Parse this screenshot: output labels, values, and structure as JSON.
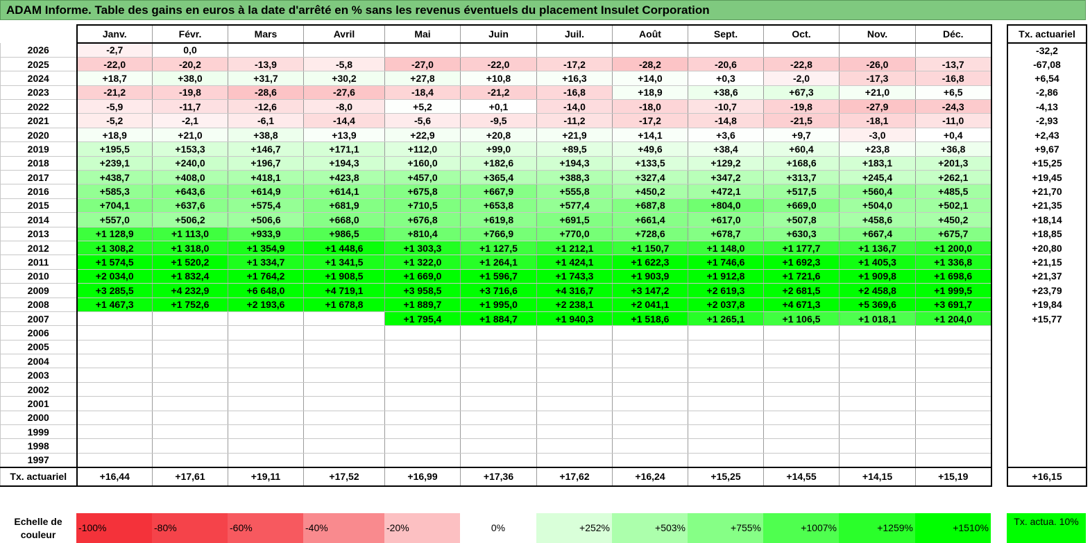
{
  "title": "ADAM Informe. Table des gains en euros à la date d'arrêté en % sans les revenus éventuels du placement Insulet Corporation",
  "chart_data": {
    "type": "table",
    "title": "ADAM Informe. Table des gains en euros à la date d'arrêté en % sans les revenus éventuels du placement Insulet Corporation",
    "columns": [
      "Janv.",
      "Févr.",
      "Mars",
      "Avril",
      "Mai",
      "Juin",
      "Juil.",
      "Août",
      "Sept.",
      "Oct.",
      "Nov.",
      "Déc."
    ],
    "side_header": "Tx. actuariel",
    "rows": [
      {
        "year": "2026",
        "values": [
          "-2,7",
          "0,0",
          "",
          "",
          "",
          "",
          "",
          "",
          "",
          "",
          "",
          ""
        ],
        "tx": "-32,2"
      },
      {
        "year": "2025",
        "values": [
          "-22,0",
          "-20,2",
          "-13,9",
          "-5,8",
          "-27,0",
          "-22,0",
          "-17,2",
          "-28,2",
          "-20,6",
          "-22,8",
          "-26,0",
          "-13,7"
        ],
        "tx": "-67,08"
      },
      {
        "year": "2024",
        "values": [
          "+18,7",
          "+38,0",
          "+31,7",
          "+30,2",
          "+27,8",
          "+10,8",
          "+16,3",
          "+14,0",
          "+0,3",
          "-2,0",
          "-17,3",
          "-16,8"
        ],
        "tx": "+6,54"
      },
      {
        "year": "2023",
        "values": [
          "-21,2",
          "-19,8",
          "-28,6",
          "-27,6",
          "-18,4",
          "-21,2",
          "-16,8",
          "+18,9",
          "+38,6",
          "+67,3",
          "+21,0",
          "+6,5"
        ],
        "tx": "-2,86"
      },
      {
        "year": "2022",
        "values": [
          "-5,9",
          "-11,7",
          "-12,6",
          "-8,0",
          "+5,2",
          "+0,1",
          "-14,0",
          "-18,0",
          "-10,7",
          "-19,8",
          "-27,9",
          "-24,3"
        ],
        "tx": "-4,13"
      },
      {
        "year": "2021",
        "values": [
          "-5,2",
          "-2,1",
          "-6,1",
          "-14,4",
          "-5,6",
          "-9,5",
          "-11,2",
          "-17,2",
          "-14,8",
          "-21,5",
          "-18,1",
          "-11,0"
        ],
        "tx": "-2,93"
      },
      {
        "year": "2020",
        "values": [
          "+18,9",
          "+21,0",
          "+38,8",
          "+13,9",
          "+22,9",
          "+20,8",
          "+21,9",
          "+14,1",
          "+3,6",
          "+9,7",
          "-3,0",
          "+0,4"
        ],
        "tx": "+2,43"
      },
      {
        "year": "2019",
        "values": [
          "+195,5",
          "+153,3",
          "+146,7",
          "+171,1",
          "+112,0",
          "+99,0",
          "+89,5",
          "+49,6",
          "+38,4",
          "+60,4",
          "+23,8",
          "+36,8"
        ],
        "tx": "+9,67"
      },
      {
        "year": "2018",
        "values": [
          "+239,1",
          "+240,0",
          "+196,7",
          "+194,3",
          "+160,0",
          "+182,6",
          "+194,3",
          "+133,5",
          "+129,2",
          "+168,6",
          "+183,1",
          "+201,3"
        ],
        "tx": "+15,25"
      },
      {
        "year": "2017",
        "values": [
          "+438,7",
          "+408,0",
          "+418,1",
          "+423,8",
          "+457,0",
          "+365,4",
          "+388,3",
          "+327,4",
          "+347,2",
          "+313,7",
          "+245,4",
          "+262,1"
        ],
        "tx": "+19,45"
      },
      {
        "year": "2016",
        "values": [
          "+585,3",
          "+643,6",
          "+614,9",
          "+614,1",
          "+675,8",
          "+667,9",
          "+555,8",
          "+450,2",
          "+472,1",
          "+517,5",
          "+560,4",
          "+485,5"
        ],
        "tx": "+21,70"
      },
      {
        "year": "2015",
        "values": [
          "+704,1",
          "+637,6",
          "+575,4",
          "+681,9",
          "+710,5",
          "+653,8",
          "+577,4",
          "+687,8",
          "+804,0",
          "+669,0",
          "+504,0",
          "+502,1"
        ],
        "tx": "+21,35"
      },
      {
        "year": "2014",
        "values": [
          "+557,0",
          "+506,2",
          "+506,6",
          "+668,0",
          "+676,8",
          "+619,8",
          "+691,5",
          "+661,4",
          "+617,0",
          "+507,8",
          "+458,6",
          "+450,2"
        ],
        "tx": "+18,14"
      },
      {
        "year": "2013",
        "values": [
          "+1 128,9",
          "+1 113,0",
          "+933,9",
          "+986,5",
          "+810,4",
          "+766,9",
          "+770,0",
          "+728,6",
          "+678,7",
          "+630,3",
          "+667,4",
          "+675,7"
        ],
        "tx": "+18,85"
      },
      {
        "year": "2012",
        "values": [
          "+1 308,2",
          "+1 318,0",
          "+1 354,9",
          "+1 448,6",
          "+1 303,3",
          "+1 127,5",
          "+1 212,1",
          "+1 150,7",
          "+1 148,0",
          "+1 177,7",
          "+1 136,7",
          "+1 200,0"
        ],
        "tx": "+20,80"
      },
      {
        "year": "2011",
        "values": [
          "+1 574,5",
          "+1 520,2",
          "+1 334,7",
          "+1 341,5",
          "+1 322,0",
          "+1 264,1",
          "+1 424,1",
          "+1 622,3",
          "+1 746,6",
          "+1 692,3",
          "+1 405,3",
          "+1 336,8"
        ],
        "tx": "+21,15"
      },
      {
        "year": "2010",
        "values": [
          "+2 034,0",
          "+1 832,4",
          "+1 764,2",
          "+1 908,5",
          "+1 669,0",
          "+1 596,7",
          "+1 743,3",
          "+1 903,9",
          "+1 912,8",
          "+1 721,6",
          "+1 909,8",
          "+1 698,6"
        ],
        "tx": "+21,37"
      },
      {
        "year": "2009",
        "values": [
          "+3 285,5",
          "+4 232,9",
          "+6 648,0",
          "+4 719,1",
          "+3 958,5",
          "+3 716,6",
          "+4 316,7",
          "+3 147,2",
          "+2 619,3",
          "+2 681,5",
          "+2 458,8",
          "+1 999,5"
        ],
        "tx": "+23,79"
      },
      {
        "year": "2008",
        "values": [
          "+1 467,3",
          "+1 752,6",
          "+2 193,6",
          "+1 678,8",
          "+1 889,7",
          "+1 995,0",
          "+2 238,1",
          "+2 041,1",
          "+2 037,8",
          "+4 671,3",
          "+5 369,6",
          "+3 691,7"
        ],
        "tx": "+19,84"
      },
      {
        "year": "2007",
        "values": [
          "",
          "",
          "",
          "",
          "+1 795,4",
          "+1 884,7",
          "+1 940,3",
          "+1 518,6",
          "+1 265,1",
          "+1 106,5",
          "+1 018,1",
          "+1 204,0"
        ],
        "tx": "+15,77"
      },
      {
        "year": "2006",
        "values": [
          "",
          "",
          "",
          "",
          "",
          "",
          "",
          "",
          "",
          "",
          "",
          ""
        ],
        "tx": ""
      },
      {
        "year": "2005",
        "values": [
          "",
          "",
          "",
          "",
          "",
          "",
          "",
          "",
          "",
          "",
          "",
          ""
        ],
        "tx": ""
      },
      {
        "year": "2004",
        "values": [
          "",
          "",
          "",
          "",
          "",
          "",
          "",
          "",
          "",
          "",
          "",
          ""
        ],
        "tx": ""
      },
      {
        "year": "2003",
        "values": [
          "",
          "",
          "",
          "",
          "",
          "",
          "",
          "",
          "",
          "",
          "",
          ""
        ],
        "tx": ""
      },
      {
        "year": "2002",
        "values": [
          "",
          "",
          "",
          "",
          "",
          "",
          "",
          "",
          "",
          "",
          "",
          ""
        ],
        "tx": ""
      },
      {
        "year": "2001",
        "values": [
          "",
          "",
          "",
          "",
          "",
          "",
          "",
          "",
          "",
          "",
          "",
          ""
        ],
        "tx": ""
      },
      {
        "year": "2000",
        "values": [
          "",
          "",
          "",
          "",
          "",
          "",
          "",
          "",
          "",
          "",
          "",
          ""
        ],
        "tx": ""
      },
      {
        "year": "1999",
        "values": [
          "",
          "",
          "",
          "",
          "",
          "",
          "",
          "",
          "",
          "",
          "",
          ""
        ],
        "tx": ""
      },
      {
        "year": "1998",
        "values": [
          "",
          "",
          "",
          "",
          "",
          "",
          "",
          "",
          "",
          "",
          "",
          ""
        ],
        "tx": ""
      },
      {
        "year": "1997",
        "values": [
          "",
          "",
          "",
          "",
          "",
          "",
          "",
          "",
          "",
          "",
          "",
          ""
        ],
        "tx": ""
      }
    ],
    "total_row": {
      "label": "Tx. actuariel",
      "values": [
        "+16,44",
        "+17,61",
        "+19,11",
        "+17,52",
        "+16,99",
        "+17,36",
        "+17,62",
        "+16,24",
        "+15,25",
        "+14,55",
        "+14,15",
        "+15,19"
      ],
      "tx": "+16,15"
    },
    "color_scale": {
      "label": "Echelle de couleur",
      "stops": [
        {
          "label": "-100%",
          "color": "#f4323a"
        },
        {
          "label": "-80%",
          "color": "#f5434a"
        },
        {
          "label": "-60%",
          "color": "#f7595f"
        },
        {
          "label": "-40%",
          "color": "#f98a8e"
        },
        {
          "label": "-20%",
          "color": "#fcc0c2"
        },
        {
          "label": "0%",
          "color": "#ffffff"
        },
        {
          "label": "+252%",
          "color": "#d9ffd9"
        },
        {
          "label": "+503%",
          "color": "#acffac"
        },
        {
          "label": "+755%",
          "color": "#86ff86"
        },
        {
          "label": "+1007%",
          "color": "#4fff4f"
        },
        {
          "label": "+1259%",
          "color": "#2aff2a"
        },
        {
          "label": "+1510%",
          "color": "#00ff00"
        }
      ],
      "tx_label": "Tx. actua. 10%",
      "tx_color": "#00ff00"
    }
  }
}
